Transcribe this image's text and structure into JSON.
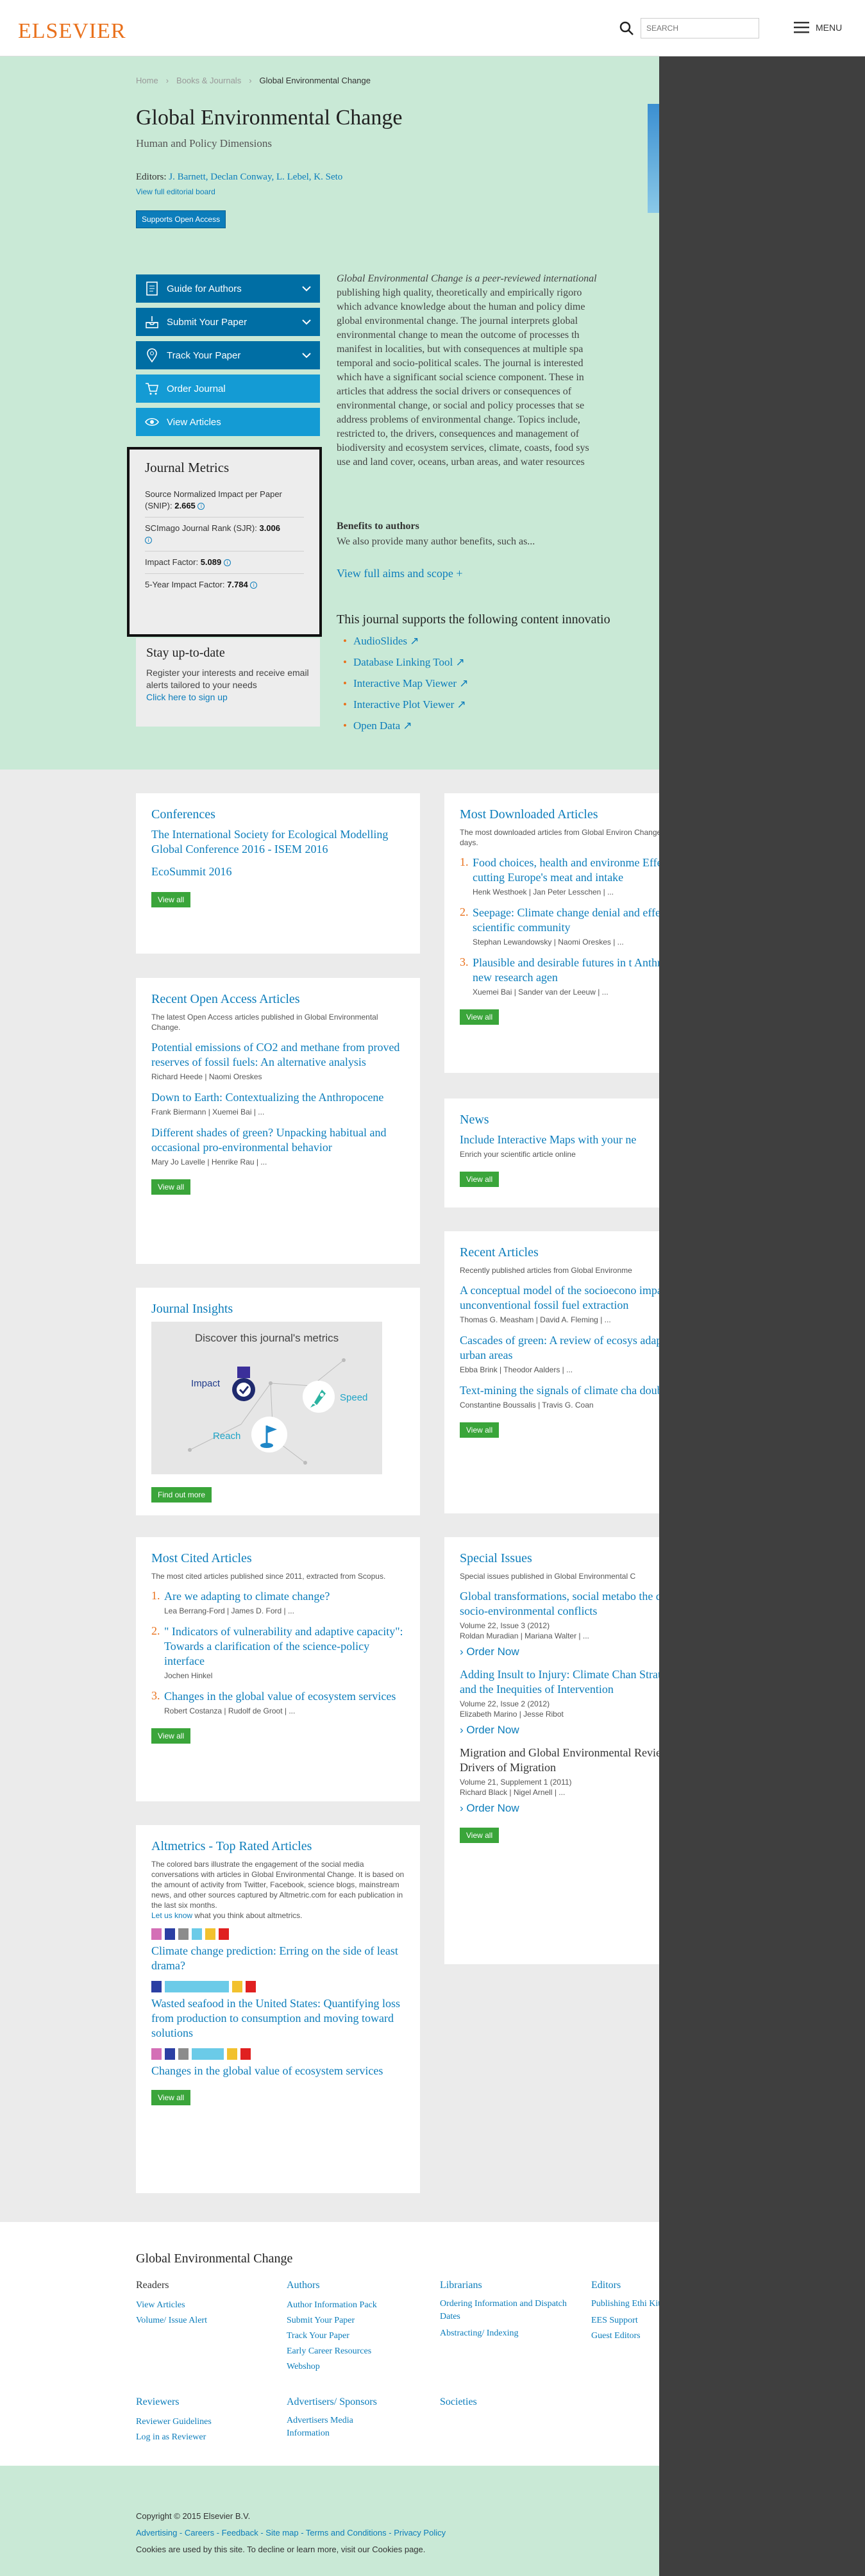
{
  "header": {
    "logo": "ELSEVIER",
    "search_placeholder": "SEARCH",
    "menu_label": "MENU"
  },
  "breadcrumb": [
    "Home",
    "Books & Journals",
    "Global Environmental Change"
  ],
  "journal": {
    "title": "Global Environmental Change",
    "subtitle": "Human and Policy Dimensions",
    "editors_label": "Editors:",
    "editors": "J. Barnett, Declan Conway, L. Lebel, K. Seto",
    "editorial_board_link": "View full editorial board",
    "open_access_button": "Supports Open Access"
  },
  "nav_buttons": [
    {
      "label": "Guide for Authors",
      "icon": "document-icon"
    },
    {
      "label": "Submit Your Paper",
      "icon": "inbox-icon"
    },
    {
      "label": "Track Your Paper",
      "icon": "location-pin-icon"
    },
    {
      "label": "Order Journal",
      "icon": "cart-icon"
    },
    {
      "label": "View Articles",
      "icon": "eye-icon"
    }
  ],
  "metrics": {
    "title": "Journal Metrics",
    "snip_label": "Source Normalized Impact per Paper (SNIP):",
    "snip_value": "2.665",
    "sjr_label": "SCImago Journal Rank (SJR):",
    "sjr_value": "3.006",
    "if_label": "Impact Factor:",
    "if_value": "5.089",
    "if5_label": "5-Year Impact Factor:",
    "if5_value": "7.784"
  },
  "stay": {
    "title": "Stay up-to-date",
    "text": "Register your interests and receive email alerts tailored to your needs",
    "link": "Click here to sign up"
  },
  "about": {
    "lines": [
      "Global Environmental Change is a peer-reviewed international",
      "publishing high quality, theoretically and empirically rigoro",
      "which advance knowledge about the human and policy dime",
      "global environmental change. The journal interprets global",
      "environmental change to mean the outcome of processes th",
      "manifest in localities, but with consequences at multiple spa",
      "temporal and socio-political scales. The journal is interested",
      "which have a significant social science component. These in",
      "articles that address the social drivers or consequences of",
      "environmental change, or social and policy processes that se",
      "address problems of environmental change. Topics include,",
      "restricted to, the drivers, consequences and management of",
      "biodiversity and ecosystem services, climate, coasts, food sys",
      "use and land cover, oceans, urban areas, and water resources"
    ],
    "benefits_title": "Benefits to authors",
    "benefits_text": "We also provide many author benefits, such as...",
    "aims_link": "View full aims and scope +"
  },
  "innovations": {
    "title": "This journal supports the following content innovatio",
    "items": [
      "AudioSlides",
      "Database Linking Tool",
      "Interactive Map Viewer",
      "Interactive Plot Viewer",
      "Open Data"
    ]
  },
  "conferences": {
    "title": "Conferences",
    "items": [
      "The International Society for Ecological Modelling Global Conference 2016 - ISEM 2016",
      "EcoSummit 2016"
    ],
    "view_all": "View all"
  },
  "most_downloaded": {
    "title": "Most Downloaded Articles",
    "desc": "The most downloaded articles from Global Environ Change in the last 90 days.",
    "items": [
      {
        "title": "Food choices, health and environme Effects of cutting Europe's meat and intake",
        "authors": "Henk Westhoek | Jan Peter Lesschen | ..."
      },
      {
        "title": "Seepage: Climate change denial and effect on the scientific community",
        "authors": "Stephan Lewandowsky | Naomi Oreskes | ..."
      },
      {
        "title": "Plausible and desirable futures in t Anthropocene: A new research agen",
        "authors": "Xuemei Bai | Sander van der Leeuw | ..."
      }
    ],
    "view_all": "View all"
  },
  "open_access": {
    "title": "Recent Open Access Articles",
    "desc": "The latest Open Access articles published in Global Environmental Change.",
    "items": [
      {
        "title": "Potential emissions of CO2 and methane from proved reserves of fossil fuels: An alternative analysis",
        "authors": "Richard Heede | Naomi Oreskes"
      },
      {
        "title": "Down to Earth: Contextualizing the Anthropocene",
        "authors": "Frank Biermann | Xuemei Bai | ..."
      },
      {
        "title": "Different shades of green? Unpacking habitual and occasional pro-environmental behavior",
        "authors": "Mary Jo Lavelle | Henrike Rau | ..."
      }
    ],
    "view_all": "View all"
  },
  "news": {
    "title": "News",
    "item_title": "Include Interactive Maps with your ne",
    "item_text": "Enrich your scientific article online",
    "view_all": "View all"
  },
  "insights": {
    "title": "Journal Insights",
    "banner_title": "Discover this journal's metrics",
    "impact": "Impact",
    "speed": "Speed",
    "reach": "Reach",
    "button": "Find out more"
  },
  "recent_articles": {
    "title": "Recent Articles",
    "desc": "Recently published articles from Global Environme",
    "items": [
      {
        "title": "A conceptual model of the socioecono impacts of unconventional fossil fuel extraction",
        "authors": "Thomas G. Measham | David A. Fleming | ..."
      },
      {
        "title": "Cascades of green: A review of ecosys adaptation in urban areas",
        "authors": "Ebba Brink | Theodor Aalders | ..."
      },
      {
        "title": "Text-mining the signals of climate cha doubt",
        "authors": "Constantine Boussalis | Travis G. Coan"
      }
    ],
    "view_all": "View all"
  },
  "most_cited": {
    "title": "Most Cited Articles",
    "desc": "The most cited articles published since 2011, extracted from Scopus.",
    "items": [
      {
        "title": "Are we adapting to climate change?",
        "authors": "Lea Berrang-Ford | James D. Ford | ..."
      },
      {
        "title": "\" Indicators of vulnerability and adaptive capacity\": Towards a clarification of the science-policy interface",
        "authors": "Jochen Hinkel"
      },
      {
        "title": "Changes in the global value of ecosystem services",
        "authors": "Robert Costanza | Rudolf de Groot | ..."
      }
    ],
    "view_all": "View all"
  },
  "special_issues": {
    "title": "Special Issues",
    "desc": "Special issues published in Global Environmental C",
    "items": [
      {
        "title": "Global transformations, social metabo the dynamics of socio-environmental conflicts",
        "volume": "Volume 22, Issue 3 (2012)",
        "authors": "Roldan Muradian | Mariana Walter | ..."
      },
      {
        "title": "Adding Insult to Injury: Climate Chan Stratification, and the Inequities of Intervention",
        "volume": "Volume 22, Issue 2 (2012)",
        "authors": "Elizabeth Marino | Jesse Ribot"
      },
      {
        "title": "Migration and Global Environmental Review of Drivers of Migration",
        "volume": "Volume 21, Supplement 1 (2011)",
        "authors": "Richard Black | Nigel Arnell | ..."
      }
    ],
    "order_now": "Order Now",
    "view_all": "View all"
  },
  "altmetrics": {
    "title": "Altmetrics - Top Rated Articles",
    "desc": "The colored bars illustrate the engagement of the social media conversations with articles in Global Environmental Change. It is based on the amount of activity from Twitter, Facebook, science blogs, mainstream news, and other sources captured by Altmetric.com for each publication in the last six months.",
    "let_us_know": "Let us know",
    "feedback_text": "what you think about altmetrics.",
    "items": [
      "Climate change prediction: Erring on the side of least drama?",
      "Wasted seafood in the United States: Quantifying loss from production to consumption and moving toward solutions",
      "Changes in the global value of ecosystem services"
    ],
    "view_all": "View all",
    "colors": [
      "#d46fb6",
      "#2b3fa3",
      "#8c8c8c",
      "#6bcbe8",
      "#f2c12e",
      "#e02020"
    ]
  },
  "footer": {
    "title": "Global Environmental Change",
    "readers": {
      "title": "Readers",
      "links": [
        "View Articles",
        "Volume/ Issue Alert"
      ]
    },
    "authors": {
      "title": "Authors",
      "links": [
        "Author Information Pack",
        "Submit Your Paper",
        "Track Your Paper",
        "Early Career Resources",
        "Webshop"
      ]
    },
    "librarians": {
      "title": "Librarians",
      "links": [
        "Ordering Information and Dispatch Dates",
        "Abstracting/ Indexing"
      ]
    },
    "editors": {
      "title": "Editors",
      "links": [
        "Publishing Ethi Kit",
        "EES Support",
        "Guest Editors"
      ]
    },
    "reviewers": {
      "title": "Reviewers",
      "links": [
        "Reviewer Guidelines",
        "Log in as Reviewer"
      ]
    },
    "advertisers": {
      "title": "Advertisers/ Sponsors",
      "links": [
        "Advertisers Media Information"
      ]
    },
    "societies": {
      "title": "Societies"
    },
    "copyright": "Copyright © 2015 Elsevier B.V.",
    "legal_links": "Advertising - Careers - Feedback - Site map - Terms and Conditions - Privacy Policy",
    "cookies": "Cookies are used by this site. To decline or learn more, visit our Cookies page."
  }
}
